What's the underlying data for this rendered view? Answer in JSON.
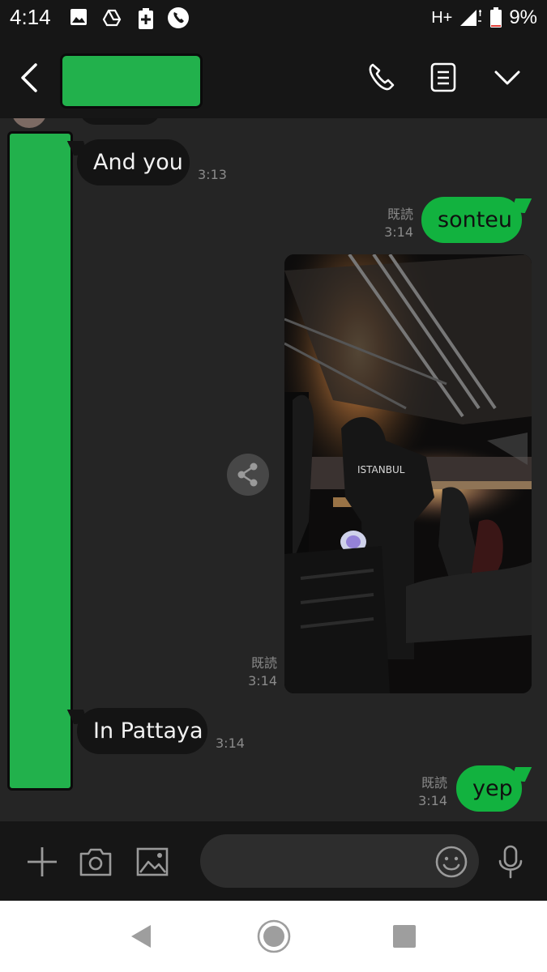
{
  "status_bar": {
    "time": "4:14",
    "network": "H+",
    "battery": "9%",
    "icons": [
      "image-icon",
      "drive-icon",
      "battery-saver-icon",
      "phone-call-icon",
      "signal-icon",
      "battery-icon"
    ]
  },
  "header": {
    "icons": [
      "back-arrow-icon",
      "phone-icon",
      "notes-icon",
      "chevron-down-icon"
    ]
  },
  "messages": [
    {
      "side": "in",
      "text": "And you",
      "time": "3:13"
    },
    {
      "side": "out",
      "text": "sonteu",
      "read": "既読",
      "time": "3:14"
    },
    {
      "side": "out",
      "type": "image",
      "read": "既読",
      "time": "3:14",
      "image_text": "ISTANBUL"
    },
    {
      "side": "in",
      "text": "In Pattaya",
      "time": "3:14"
    },
    {
      "side": "out",
      "text": "yep",
      "read": "既読",
      "time": "3:14"
    }
  ],
  "input_bar": {
    "placeholder": "",
    "icons": [
      "plus-icon",
      "camera-icon",
      "gallery-icon",
      "emoji-icon",
      "microphone-icon"
    ]
  },
  "nav_bar": {
    "icons": [
      "nav-back-icon",
      "nav-home-icon",
      "nav-recents-icon"
    ]
  },
  "colors": {
    "accent_green": "#12b23f",
    "background": "#252525",
    "bar": "#161616"
  }
}
